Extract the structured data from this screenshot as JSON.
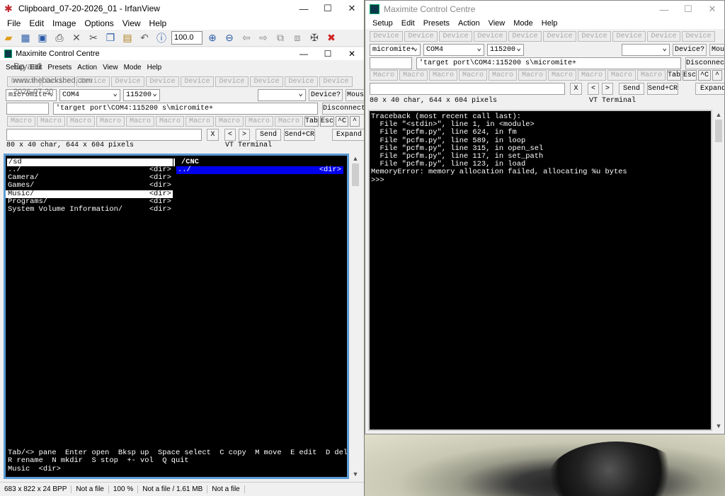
{
  "irfan": {
    "title": "Clipboard_07-20-2026_01 - IrfanView",
    "menu": [
      "File",
      "Edit",
      "Image",
      "Options",
      "View",
      "Help"
    ],
    "zoom": "100.0",
    "status": [
      "683 x 822 x 24 BPP",
      "Not a file",
      "100 %",
      "Not a file / 1.61 MB",
      "Not a file"
    ],
    "watermark": {
      "user": "Bryan1",
      "site": "www.thebackshed.com",
      "date": "2026-07-20"
    }
  },
  "left_mcc": {
    "title": "Maximite Control Centre",
    "menu": [
      "Setup",
      "Edit",
      "Presets",
      "Action",
      "View",
      "Mode",
      "Help"
    ],
    "device_label": "Device",
    "device_sel": "micromite+",
    "port_sel": "COM4",
    "baud_sel": "115200",
    "device_btn": "Device?",
    "mouse_btn": "Mous",
    "cmd_value": "'target port\\COM4:115200 s\\micromite+",
    "disconnect": "Disconnect",
    "macro_label": "Macro",
    "tab_btn": "Tab",
    "esc_btn": "Esc",
    "ctrlc_btn": "^C",
    "ctrlz_btn": "^",
    "x_btn": "X",
    "lt_btn": "<",
    "gt_btn": ">",
    "send": "Send",
    "send_cr": "Send+CR",
    "expand": "Expand",
    "info": "80 x 40 char, 644 x 604 pixels",
    "vt": "VT Terminal",
    "pane_left_title": "/sd",
    "pane_right_title": "/CNC",
    "left_entries": [
      {
        "name": "../",
        "tag": "<dir>"
      },
      {
        "name": "Camera/",
        "tag": "<dir>"
      },
      {
        "name": "Games/",
        "tag": "<dir>"
      },
      {
        "name": "Music/",
        "tag": "<dir>"
      },
      {
        "name": "Programs/",
        "tag": "<dir>"
      },
      {
        "name": "System Volume Information/",
        "tag": "<dir>"
      }
    ],
    "right_entries": [
      {
        "name": "../",
        "tag": "<dir>"
      }
    ],
    "help_line1": "Tab/<> pane  Enter open  Bksp up  Space select  C copy  M move  E edit  D del",
    "help_line2": "R rename  N mkdir  S stop  +- vol  Q quit",
    "status_line": "Music  <dir>"
  },
  "right_mcc": {
    "title": "Maximite Control Centre",
    "menu": [
      "Setup",
      "Edit",
      "Presets",
      "Action",
      "View",
      "Mode",
      "Help"
    ],
    "device_sel": "micromite+",
    "port_sel": "COM4",
    "baud_sel": "115200",
    "device_btn": "Device?",
    "mouse_btn": "Mous",
    "cmd_value": "'target port\\COM4:115200 s\\micromite+",
    "disconnect": "Disconnect",
    "info": "80 x 40 char, 644 x 604 pixels",
    "vt": "VT Terminal",
    "expand": "Expand",
    "traceback": [
      "Traceback (most recent call last):",
      "  File \"<stdin>\", line 1, in <module>",
      "  File \"pcfm.py\", line 624, in fm",
      "  File \"pcfm.py\", line 589, in loop",
      "  File \"pcfm.py\", line 315, in open_sel",
      "  File \"pcfm.py\", line 117, in set_path",
      "  File \"pcfm.py\", line 123, in load",
      "MemoryError: memory allocation failed, allocating %u bytes",
      ">>>"
    ]
  },
  "colors": {
    "terminal_bg": "#000000",
    "terminal_fg": "#ffffff",
    "selection": "#0000ee",
    "highlight_row": "#ffffff",
    "pane_frame": "#5b9bd5"
  }
}
